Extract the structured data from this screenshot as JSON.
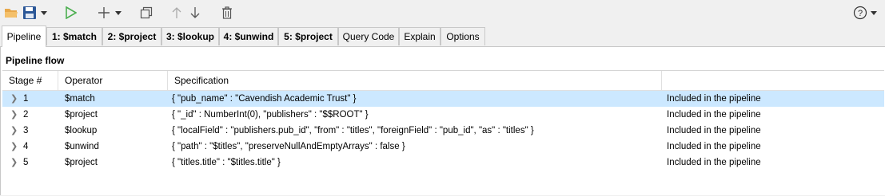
{
  "toolbar": {
    "icons": [
      "folder-open-icon",
      "save-icon",
      "dropdown-arrow-icon",
      "run-icon",
      "add-icon",
      "dropdown-arrow-icon",
      "duplicate-icon",
      "move-up-icon",
      "move-down-icon",
      "delete-icon",
      "help-icon",
      "dropdown-arrow-icon"
    ]
  },
  "tabs": [
    {
      "label": "Pipeline",
      "active": true
    },
    {
      "label": "1: $match",
      "bold": true
    },
    {
      "label": "2: $project",
      "bold": true
    },
    {
      "label": "3: $lookup",
      "bold": true
    },
    {
      "label": "4: $unwind",
      "bold": true
    },
    {
      "label": "5: $project",
      "bold": true
    },
    {
      "label": "Query Code"
    },
    {
      "label": "Explain"
    },
    {
      "label": "Options"
    }
  ],
  "section_title": "Pipeline flow",
  "columns": [
    "Stage #",
    "Operator",
    "Specification",
    ""
  ],
  "rows": [
    {
      "stage": "1",
      "operator": "$match",
      "spec": "{ \"pub_name\" : \"Cavendish Academic Trust\" }",
      "status": "Included in the pipeline",
      "selected": true
    },
    {
      "stage": "2",
      "operator": "$project",
      "spec": "{ \"_id\" : NumberInt(0), \"publishers\" : \"$$ROOT\" }",
      "status": "Included in the pipeline"
    },
    {
      "stage": "3",
      "operator": "$lookup",
      "spec": "{ \"localField\" : \"publishers.pub_id\", \"from\" : \"titles\", \"foreignField\" : \"pub_id\", \"as\" : \"titles\" }",
      "status": "Included in the pipeline"
    },
    {
      "stage": "4",
      "operator": "$unwind",
      "spec": "{ \"path\" : \"$titles\", \"preserveNullAndEmptyArrays\" : false }",
      "status": "Included in the pipeline"
    },
    {
      "stage": "5",
      "operator": "$project",
      "spec": "{ \"titles.title\" : \"$titles.title\" }",
      "status": "Included in the pipeline"
    }
  ],
  "colors": {
    "selected_row": "#cce8ff",
    "run_green": "#4caf50",
    "folder": "#e8a84a",
    "save": "#2b5797"
  }
}
